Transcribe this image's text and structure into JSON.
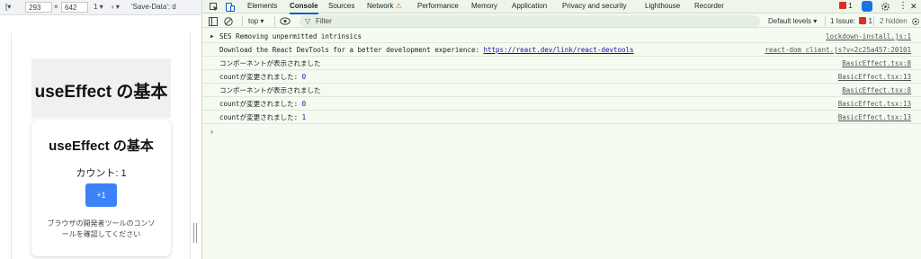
{
  "device_toolbar": {
    "width": "293",
    "separator": "×",
    "height": "642",
    "scale": "1",
    "save_data": "'Save-Data': d"
  },
  "app": {
    "hero_title": "useEffect の基本",
    "card_title": "useEffect の基本",
    "count_text": "カウント: 1",
    "increment_button": "+1",
    "hint_text": "ブラウザの開発者ツールのコンソールを確認してください"
  },
  "devtools": {
    "tabs": [
      {
        "label": "Elements"
      },
      {
        "label": "Console"
      },
      {
        "label": "Sources"
      },
      {
        "label": "Network"
      },
      {
        "label": "Performance"
      },
      {
        "label": "Memory"
      },
      {
        "label": "Application"
      },
      {
        "label": "Privacy and security"
      },
      {
        "label": "Lighthouse"
      },
      {
        "label": "Recorder"
      }
    ],
    "active_tab": "Console",
    "network_warning": "⚠",
    "error_badge_count": "1",
    "top_context": "top",
    "filter_placeholder": "Filter",
    "default_levels": "Default levels",
    "issues_label": "1 Issue:",
    "issues_count": "1",
    "hidden_label": "2 hidden",
    "accent_color": "#0b57d0",
    "error_color": "#d93025"
  },
  "console": {
    "messages": [
      {
        "text": "SES Removing unpermitted intrinsics",
        "source": "lockdown-install.js:1"
      },
      {
        "text": "Download the React DevTools for a better development experience: ",
        "link": "https://react.dev/link/react-devtools",
        "source": "react-dom_client.js?v=2c25a457:20101"
      },
      {
        "text": "コンポーネントが表示されました",
        "source": "BasicEffect.tsx:8"
      },
      {
        "text": "countが変更されました: ",
        "value": "0",
        "source": "BasicEffect.tsx:13"
      },
      {
        "text": "コンポーネントが表示されました",
        "source": "BasicEffect.tsx:8"
      },
      {
        "text": "countが変更されました: ",
        "value": "0",
        "source": "BasicEffect.tsx:13"
      },
      {
        "text": "countが変更されました: ",
        "value": "1",
        "source": "BasicEffect.tsx:13"
      }
    ],
    "prompt": "›"
  }
}
